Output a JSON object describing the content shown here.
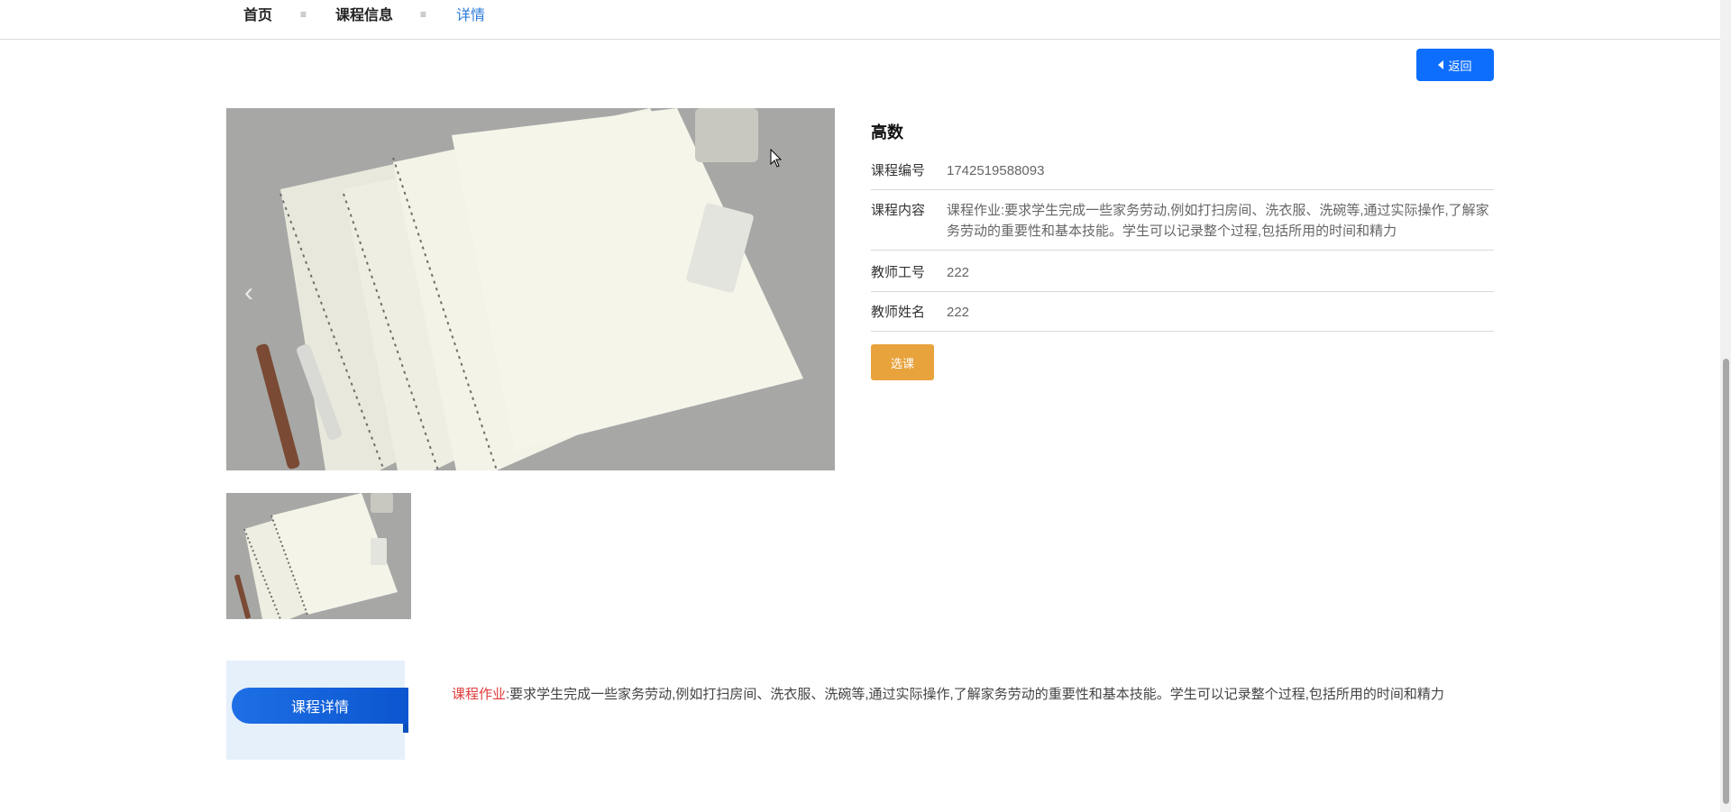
{
  "breadcrumb": {
    "home": "首页",
    "separator": "≡",
    "course_info": "课程信息",
    "current": "详情"
  },
  "back_button": {
    "label": "返回",
    "icon": "caret-left-icon"
  },
  "course": {
    "name": "高数",
    "fields": [
      {
        "label": "课程编号",
        "value": "1742519588093"
      },
      {
        "label": "课程内容",
        "value": "课程作业:要求学生完成一些家务劳动,例如打扫房间、洗衣服、洗碗等,通过实际操作,了解家务劳动的重要性和基本技能。学生可以记录整个过程,包括所用的时间和精力"
      },
      {
        "label": "教师工号",
        "value": "222"
      },
      {
        "label": "教师姓名",
        "value": "222"
      }
    ],
    "select_button": "选课"
  },
  "carousel": {
    "prev_icon": "chevron-left-icon"
  },
  "detail": {
    "tab_label": "课程详情",
    "highlight": "课程作业",
    "text": ":要求学生完成一些家务劳动,例如打扫房间、洗衣服、洗碗等,通过实际操作,了解家务劳动的重要性和基本技能。学生可以记录整个过程,包括所用的时间和精力"
  },
  "colors": {
    "primary": "#0d6efd",
    "select_button": "#e8a33d",
    "breadcrumb_active": "#2b7bd6",
    "highlight": "#e03b3b",
    "detail_panel": "#e6f0fb"
  }
}
